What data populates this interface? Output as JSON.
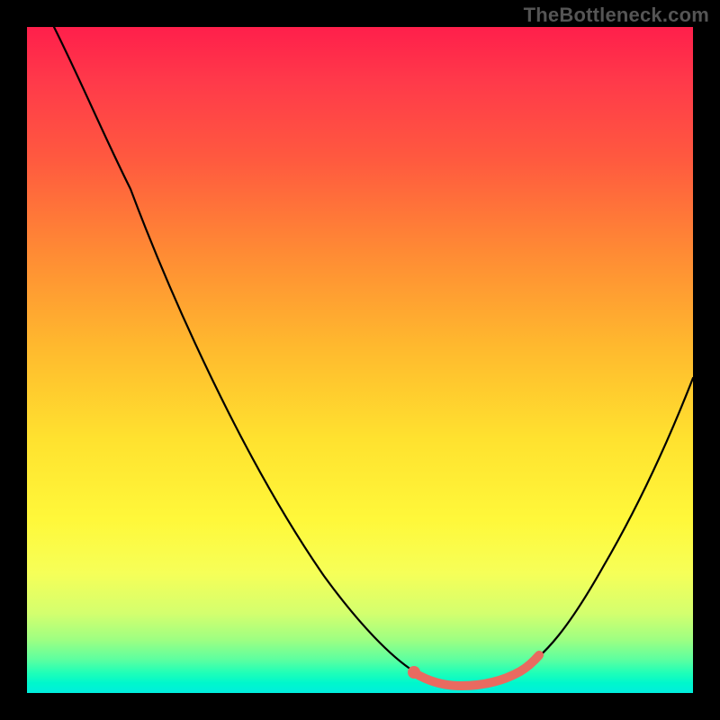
{
  "watermark": "TheBottleneck.com",
  "colors": {
    "background": "#000000",
    "curve": "#000000",
    "highlight": "#e96a60",
    "gradient_top": "#ff1f4b",
    "gradient_bottom": "#00eedd"
  },
  "chart_data": {
    "type": "line",
    "title": "",
    "xlabel": "",
    "ylabel": "",
    "xlim": [
      0,
      100
    ],
    "ylim": [
      0,
      100
    ],
    "grid": false,
    "curve": {
      "name": "bottleneck-curve",
      "points": [
        {
          "x": 4,
          "y": 100
        },
        {
          "x": 10,
          "y": 88
        },
        {
          "x": 18,
          "y": 71
        },
        {
          "x": 26,
          "y": 55
        },
        {
          "x": 34,
          "y": 40
        },
        {
          "x": 42,
          "y": 25
        },
        {
          "x": 50,
          "y": 12
        },
        {
          "x": 56,
          "y": 4
        },
        {
          "x": 60,
          "y": 1
        },
        {
          "x": 65,
          "y": 0
        },
        {
          "x": 70,
          "y": 0
        },
        {
          "x": 75,
          "y": 2
        },
        {
          "x": 80,
          "y": 8
        },
        {
          "x": 86,
          "y": 18
        },
        {
          "x": 92,
          "y": 30
        },
        {
          "x": 100,
          "y": 48
        }
      ]
    },
    "highlight_segment": {
      "name": "optimal-range",
      "start_x": 59,
      "end_x": 76
    }
  }
}
